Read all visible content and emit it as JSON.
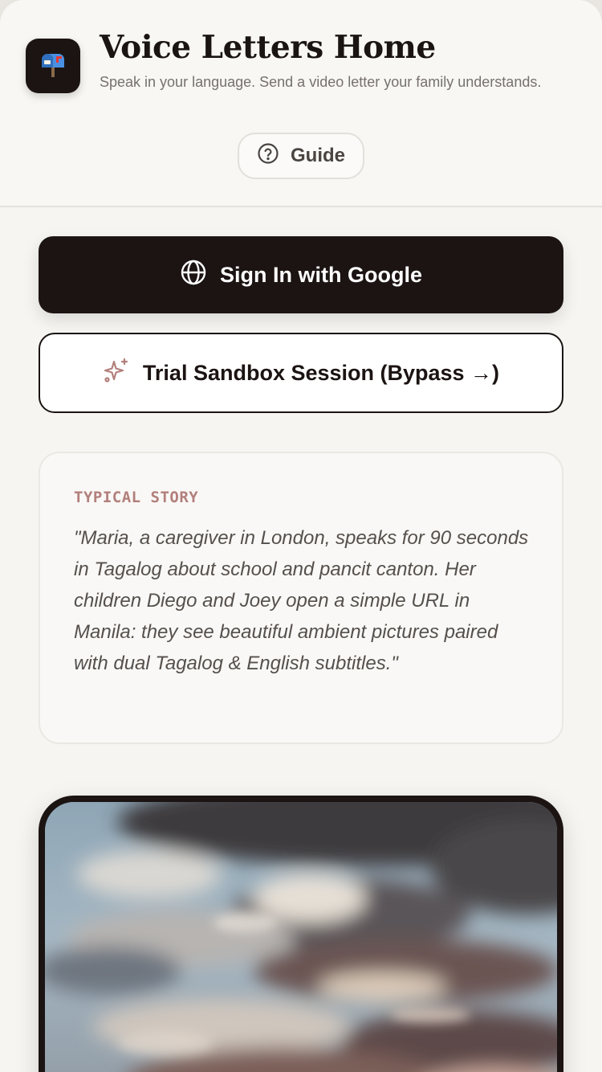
{
  "app": {
    "icon": "mailbox-icon",
    "title": "Voice Letters Home",
    "subtitle": "Speak in your language. Send a video letter your family understands."
  },
  "header": {
    "guide_label": "Guide",
    "guide_icon": "help-circle-icon"
  },
  "auth": {
    "google_label": "Sign In with Google",
    "google_icon": "globe-icon",
    "sandbox_label": "Trial Sandbox Session (Bypass →)",
    "sandbox_icon": "sparkles-icon"
  },
  "story": {
    "label": "TYPICAL STORY",
    "text": "\"Maria, a caregiver in London, speaks for 90 seconds in Tagalog about school and pancit canton. Her children Diego and Joey open a simple URL in Manila: they see beautiful ambient pictures paired with dual Tagalog & English subtitles.\""
  },
  "colors": {
    "primary": "#1b1413",
    "accent": "#b27f7b",
    "background": "#f6f5f2"
  }
}
